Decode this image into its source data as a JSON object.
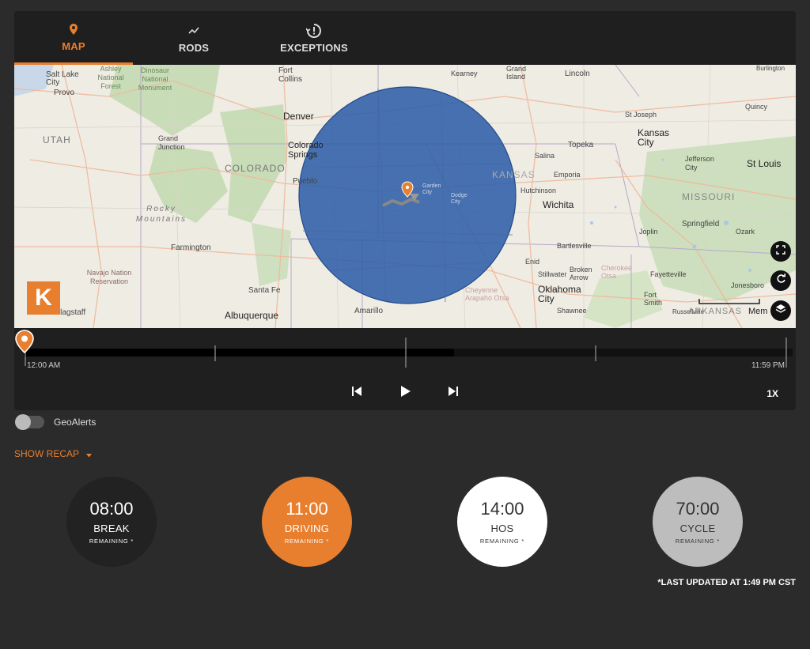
{
  "tabs": [
    {
      "label": "MAP",
      "icon": "map-pin-icon",
      "active": true
    },
    {
      "label": "RODS",
      "icon": "trend-line-icon",
      "active": false
    },
    {
      "label": "EXCEPTIONS",
      "icon": "alert-clock-icon",
      "active": false
    }
  ],
  "map": {
    "labels": {
      "salt_lake": "Salt Lake City",
      "provo": "Provo",
      "ashley": "Ashley National Forest",
      "dinosaur": "Dinosaur National Monument",
      "fort_collins": "Fort Collins",
      "denver": "Denver",
      "utah": "UTAH",
      "grand_junction": "Grand Junction",
      "colorado": "COLORADO",
      "colorado_springs": "Colorado Springs",
      "pueblo": "Pueblo",
      "rocky": "Rocky Mountains",
      "farmington": "Farmington",
      "navajo": "Navajo Nation Reservation",
      "santa_fe": "Santa Fe",
      "albuquerque": "Albuquerque",
      "amarillo": "Amarillo",
      "flagstaff": "Flagstaff",
      "kearney": "Kearney",
      "grand_island": "Grand Island",
      "lincoln": "Lincoln",
      "st_joseph": "St Joseph",
      "kansas_city": "Kansas City",
      "topeka": "Topeka",
      "salina": "Salina",
      "emporia": "Emporia",
      "kansas": "KANSAS",
      "hutchinson": "Hutchinson",
      "wichita": "Wichita",
      "garden_city": "Garden City",
      "dodge_city": "Dodge City",
      "jefferson_city": "Jefferson City",
      "st_louis": "St Louis",
      "missouri": "MISSOURI",
      "springfield": "Springfield",
      "joplin": "Joplin",
      "ozark": "Ozark",
      "bartlesville": "Bartlesville",
      "enid": "Enid",
      "stillwater": "Stillwater",
      "broken_arrow": "Broken Arrow",
      "cherokee": "Cherokee Otsa",
      "fayetteville": "Fayetteville",
      "jonesboro": "Jonesboro",
      "oklahoma_city": "Oklahoma City",
      "shawnee": "Shawnee",
      "cheyenne": "Cheyenne Arapaho Otsa",
      "fort_smith": "Fort Smith",
      "russellville": "Russellville",
      "arkansas": "ARKANSAS",
      "memphis": "Mem",
      "quincy": "Quincy",
      "burlington": "Burlington"
    },
    "logo_letter": "K"
  },
  "timeline": {
    "start": "12:00 AM",
    "end": "11:59 PM",
    "progress": 0.56
  },
  "controls": {
    "speed": "1X"
  },
  "geoalerts": {
    "label": "GeoAlerts",
    "enabled": false
  },
  "recap": {
    "label": "SHOW RECAP"
  },
  "dials": [
    {
      "time": "08:00",
      "label": "BREAK",
      "sub": "REMAINING *",
      "color": "#222222",
      "text": "#ffffff"
    },
    {
      "time": "11:00",
      "label": "DRIVING",
      "sub": "REMAINING *",
      "color": "#e87f2f",
      "text": "#ffffff"
    },
    {
      "time": "14:00",
      "label": "HOS",
      "sub": "REMAINING *",
      "color": "#ffffff",
      "text": "#333333"
    },
    {
      "time": "70:00",
      "label": "CYCLE",
      "sub": "REMAINING *",
      "color": "#bdbdbd",
      "text": "#333333"
    }
  ],
  "last_updated": "*LAST UPDATED AT 1:49 PM CST",
  "colors": {
    "accent": "#e87f2f",
    "radius_fill": "#2f5ea8"
  }
}
